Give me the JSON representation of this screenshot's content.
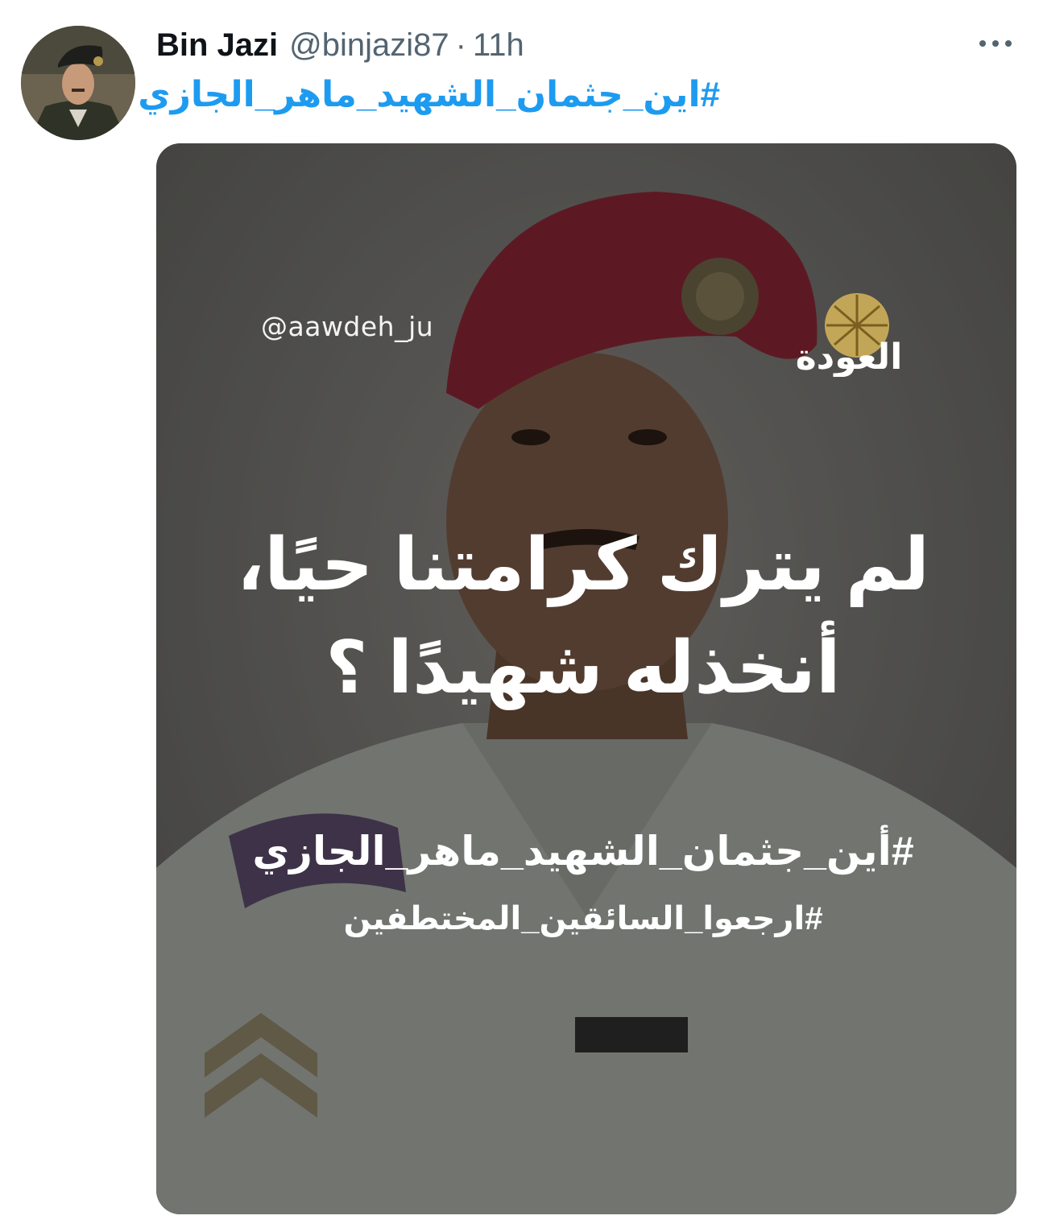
{
  "tweet": {
    "display_name": "Bin Jazi",
    "handle": "@binjazi87",
    "separator": "·",
    "time": "11h",
    "hashtag": "#اين_جثمان_الشهيد_ماهر_الجازي"
  },
  "media": {
    "watermark_handle": "@aawdeh_ju",
    "logo_text": "العودة",
    "headline_line1": "لم يترك كرامتنا حيًا،",
    "headline_line2": "أنخذله شهيدًا ؟",
    "hashtag_1": "#أين_جثمان_الشهيد_ماهر_الجازي",
    "hashtag_2": "#ارجعوا_السائقين_المختطفين"
  },
  "colors": {
    "link": "#1d9bf0",
    "name": "#0f1419",
    "secondary": "#536471",
    "beret": "#b8243a"
  },
  "icons": {
    "more": "more-horizontal-icon"
  }
}
